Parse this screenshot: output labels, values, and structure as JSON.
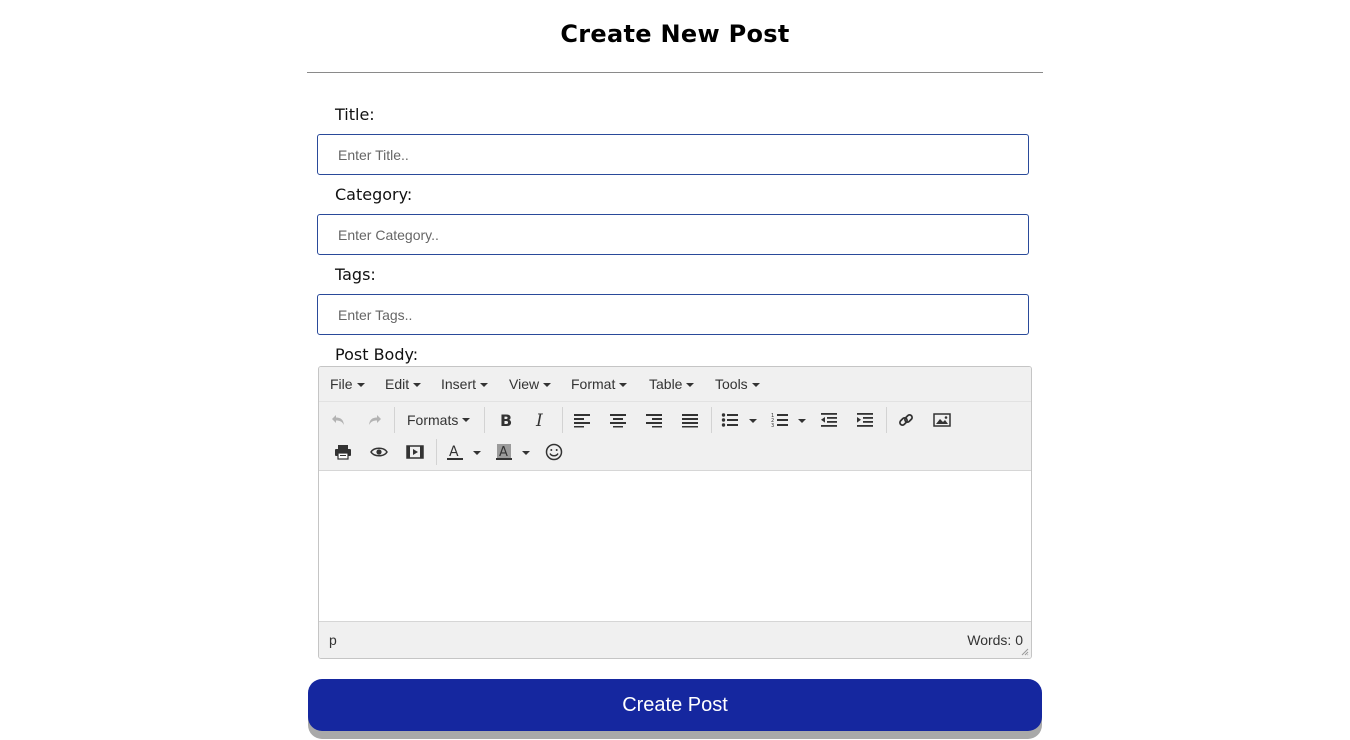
{
  "page": {
    "title": "Create New Post"
  },
  "form": {
    "title": {
      "label": "Title:",
      "value": "",
      "placeholder": "Enter Title.."
    },
    "category": {
      "label": "Category:",
      "value": "",
      "placeholder": "Enter Category.."
    },
    "tags": {
      "label": "Tags:",
      "value": "",
      "placeholder": "Enter Tags.."
    },
    "body": {
      "label": "Post Body:"
    }
  },
  "editor": {
    "menus": [
      "File",
      "Edit",
      "Insert",
      "View",
      "Format",
      "Table",
      "Tools"
    ],
    "formats_label": "Formats",
    "toolbar_icons": [
      "undo-icon",
      "redo-icon",
      "bold-icon",
      "italic-icon",
      "align-left-icon",
      "align-center-icon",
      "align-right-icon",
      "align-justify-icon",
      "bullet-list-icon",
      "numbered-list-icon",
      "outdent-icon",
      "indent-icon",
      "link-icon",
      "image-icon",
      "print-icon",
      "preview-icon",
      "media-icon",
      "text-color-icon",
      "background-color-icon",
      "emoticons-icon"
    ],
    "content": "",
    "status_path": "p",
    "word_count": "Words: 0"
  },
  "submit": {
    "label": "Create Post"
  },
  "colors": {
    "primary": "#15279f",
    "input_border": "#2a4a9a",
    "toolbar_bg": "#f0f0f0"
  }
}
